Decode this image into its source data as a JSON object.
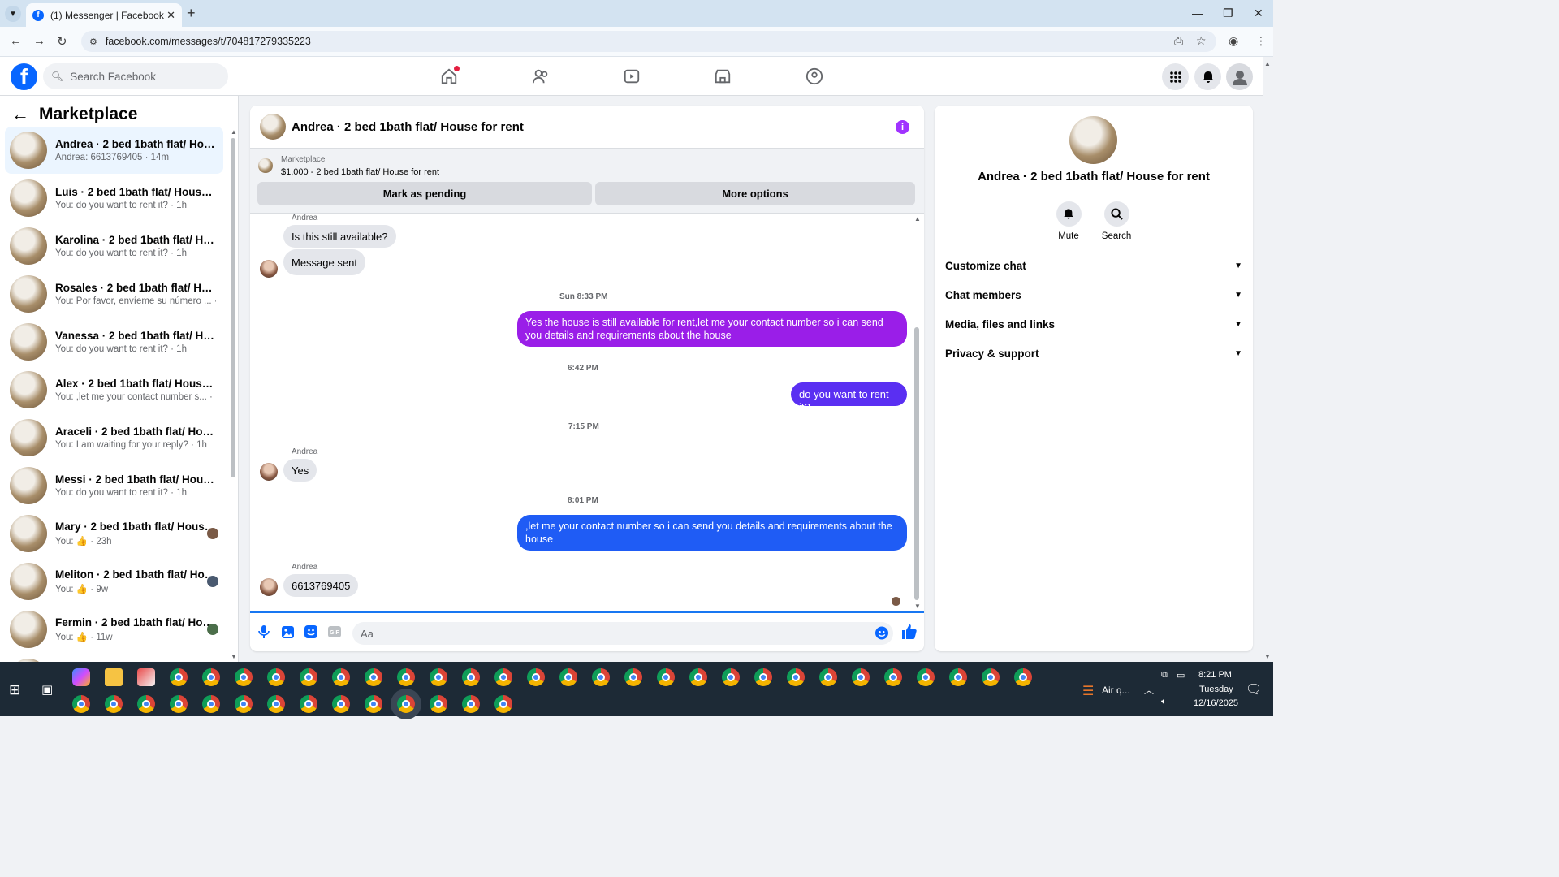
{
  "browser": {
    "tab_title": "(1) Messenger | Facebook",
    "url": "facebook.com/messages/t/704817279335223"
  },
  "fb": {
    "search_placeholder": "Search Facebook"
  },
  "left": {
    "title": "Marketplace",
    "conversations": [
      {
        "name": "Andrea · 2 bed 1bath flat/ House for rent",
        "preview": "Andrea: 6613769405 · 14m",
        "active": true
      },
      {
        "name": "Luis · 2 bed 1bath flat/ House for rent",
        "preview": "You: do you want to rent it? · 1h"
      },
      {
        "name": "Karolina · 2 bed 1bath flat/ House for rent",
        "preview": "You: do you want to rent it? · 1h"
      },
      {
        "name": "Rosales · 2 bed 1bath flat/ House for rent",
        "preview": "You: Por favor, envíeme su número ... · 1h"
      },
      {
        "name": "Vanessa · 2 bed 1bath flat/ House for rent",
        "preview": "You: do you want to rent it? · 1h"
      },
      {
        "name": "Alex · 2 bed 1bath flat/ House for rent",
        "preview": "You: ,let me your contact number s... · 1h"
      },
      {
        "name": "Araceli · 2 bed 1bath flat/ House for rent",
        "preview": "You: I am waiting for your reply? · 1h"
      },
      {
        "name": "Messi · 2 bed 1bath flat/ House for rent",
        "preview": "You: do you want to rent it? · 1h"
      },
      {
        "name": "Mary · 2 bed 1bath flat/ House for rent",
        "preview": "You: 👍 · 23h"
      },
      {
        "name": "Meliton · 2 bed 1bath flat/ House for rent",
        "preview": "You: 👍 · 9w"
      },
      {
        "name": "Fermin · 2 bed 1bath flat/ House for rent",
        "preview": "You: 👍 · 11w"
      }
    ]
  },
  "chat": {
    "title": "Andrea · 2 bed 1bath flat/ House for rent",
    "marketplace_label": "Marketplace",
    "listing": "$1,000 - 2 bed 1bath flat/ House for rent",
    "btn_pending": "Mark as pending",
    "btn_more": "More options",
    "sender": "Andrea",
    "m1": "Is this still available?",
    "m2": "Message sent",
    "t1": "Sun 8:33 PM",
    "m3": "Yes the house is still available for rent,let me your contact number so i can send you details and requirements about the house",
    "t2": "6:42 PM",
    "m4": "do you want to rent it?",
    "t3": "7:15 PM",
    "m5": "Yes",
    "t4": "8:01 PM",
    "m6": ",let me your contact number so i can send you details and requirements about the house",
    "m7": "6613769405",
    "input_placeholder": "Aa"
  },
  "right": {
    "name": "Andrea · 2 bed 1bath flat/ House for rent",
    "mute": "Mute",
    "search": "Search",
    "sections": [
      "Customize chat",
      "Chat members",
      "Media, files and links",
      "Privacy & support"
    ]
  },
  "taskbar": {
    "weather": "Air q...",
    "time": "8:21 PM",
    "day": "Tuesday",
    "date": "12/16/2025"
  },
  "colors": {
    "fb_blue": "#0866ff",
    "bubble_purple": "#9a1ee8",
    "bubble_blue": "#1f5cf5"
  }
}
